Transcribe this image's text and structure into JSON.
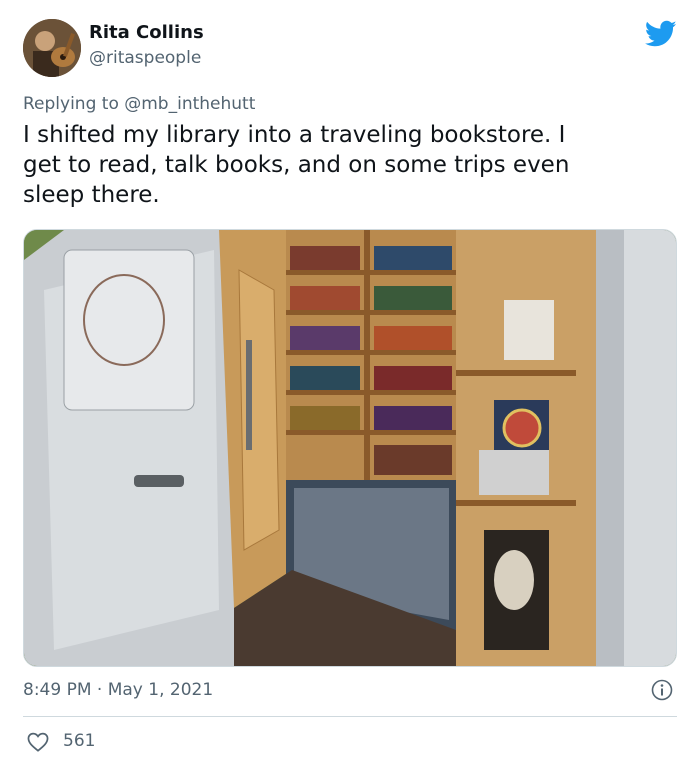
{
  "author": {
    "name": "Rita Collins",
    "handle": "@ritaspeople"
  },
  "reply": {
    "prefix": "Replying to ",
    "mention": "@mb_inthehutt"
  },
  "tweet": {
    "text": "I shifted my library into a traveling bookstore.  I\nget to read, talk books, and on some trips even\nsleep there."
  },
  "meta": {
    "timestamp": "8:49 PM · May 1, 2021"
  },
  "engagement": {
    "likes": "561"
  },
  "colors": {
    "brand": "#1d9bf0",
    "secondary_text": "#536471",
    "divider": "#cfd9de"
  },
  "icons": [
    "twitter-bird-icon",
    "info-icon",
    "heart-icon"
  ]
}
